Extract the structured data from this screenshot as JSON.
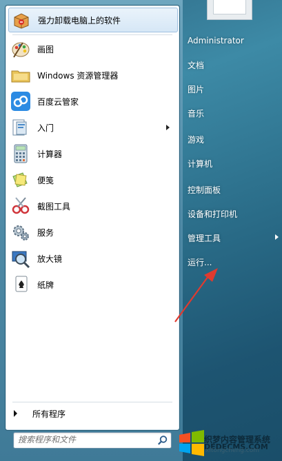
{
  "start_menu": {
    "pinned": {
      "label": "强力卸载电脑上的软件",
      "icon": "uninstall-box-icon"
    },
    "items": [
      {
        "label": "画图",
        "icon": "paint-palette-icon",
        "has_submenu": false
      },
      {
        "label": "Windows 资源管理器",
        "icon": "explorer-folder-icon",
        "has_submenu": false
      },
      {
        "label": "百度云管家",
        "icon": "baidu-cloud-icon",
        "has_submenu": false
      },
      {
        "label": "入门",
        "icon": "getting-started-icon",
        "has_submenu": true
      },
      {
        "label": "计算器",
        "icon": "calculator-icon",
        "has_submenu": false
      },
      {
        "label": "便笺",
        "icon": "sticky-notes-icon",
        "has_submenu": false
      },
      {
        "label": "截图工具",
        "icon": "snipping-tool-icon",
        "has_submenu": false
      },
      {
        "label": "服务",
        "icon": "services-gear-icon",
        "has_submenu": false
      },
      {
        "label": "放大镜",
        "icon": "magnifier-icon",
        "has_submenu": false
      },
      {
        "label": "纸牌",
        "icon": "solitaire-cards-icon",
        "has_submenu": false
      }
    ],
    "all_programs": "所有程序",
    "search": {
      "placeholder": "搜索程序和文件",
      "value": ""
    }
  },
  "right_panel": {
    "items": [
      {
        "label": "Administrator",
        "has_submenu": false
      },
      {
        "label": "文档",
        "has_submenu": false
      },
      {
        "label": "图片",
        "has_submenu": false
      },
      {
        "label": "音乐",
        "has_submenu": false
      },
      {
        "label": "游戏",
        "has_submenu": false
      },
      {
        "label": "计算机",
        "has_submenu": false
      },
      {
        "label": "控制面板",
        "has_submenu": false
      },
      {
        "label": "设备和打印机",
        "has_submenu": false
      },
      {
        "label": "管理工具",
        "has_submenu": true
      },
      {
        "label": "运行...",
        "has_submenu": false
      }
    ]
  },
  "watermark": {
    "cn_text": "织梦内容管理系统",
    "en_text": "DEDECMS.COM",
    "url": "xitongcheng.com"
  },
  "colors": {
    "annotation_arrow": "#e03a2f",
    "highlight": "#d6e7f6",
    "glass": "#3d8aa6"
  }
}
